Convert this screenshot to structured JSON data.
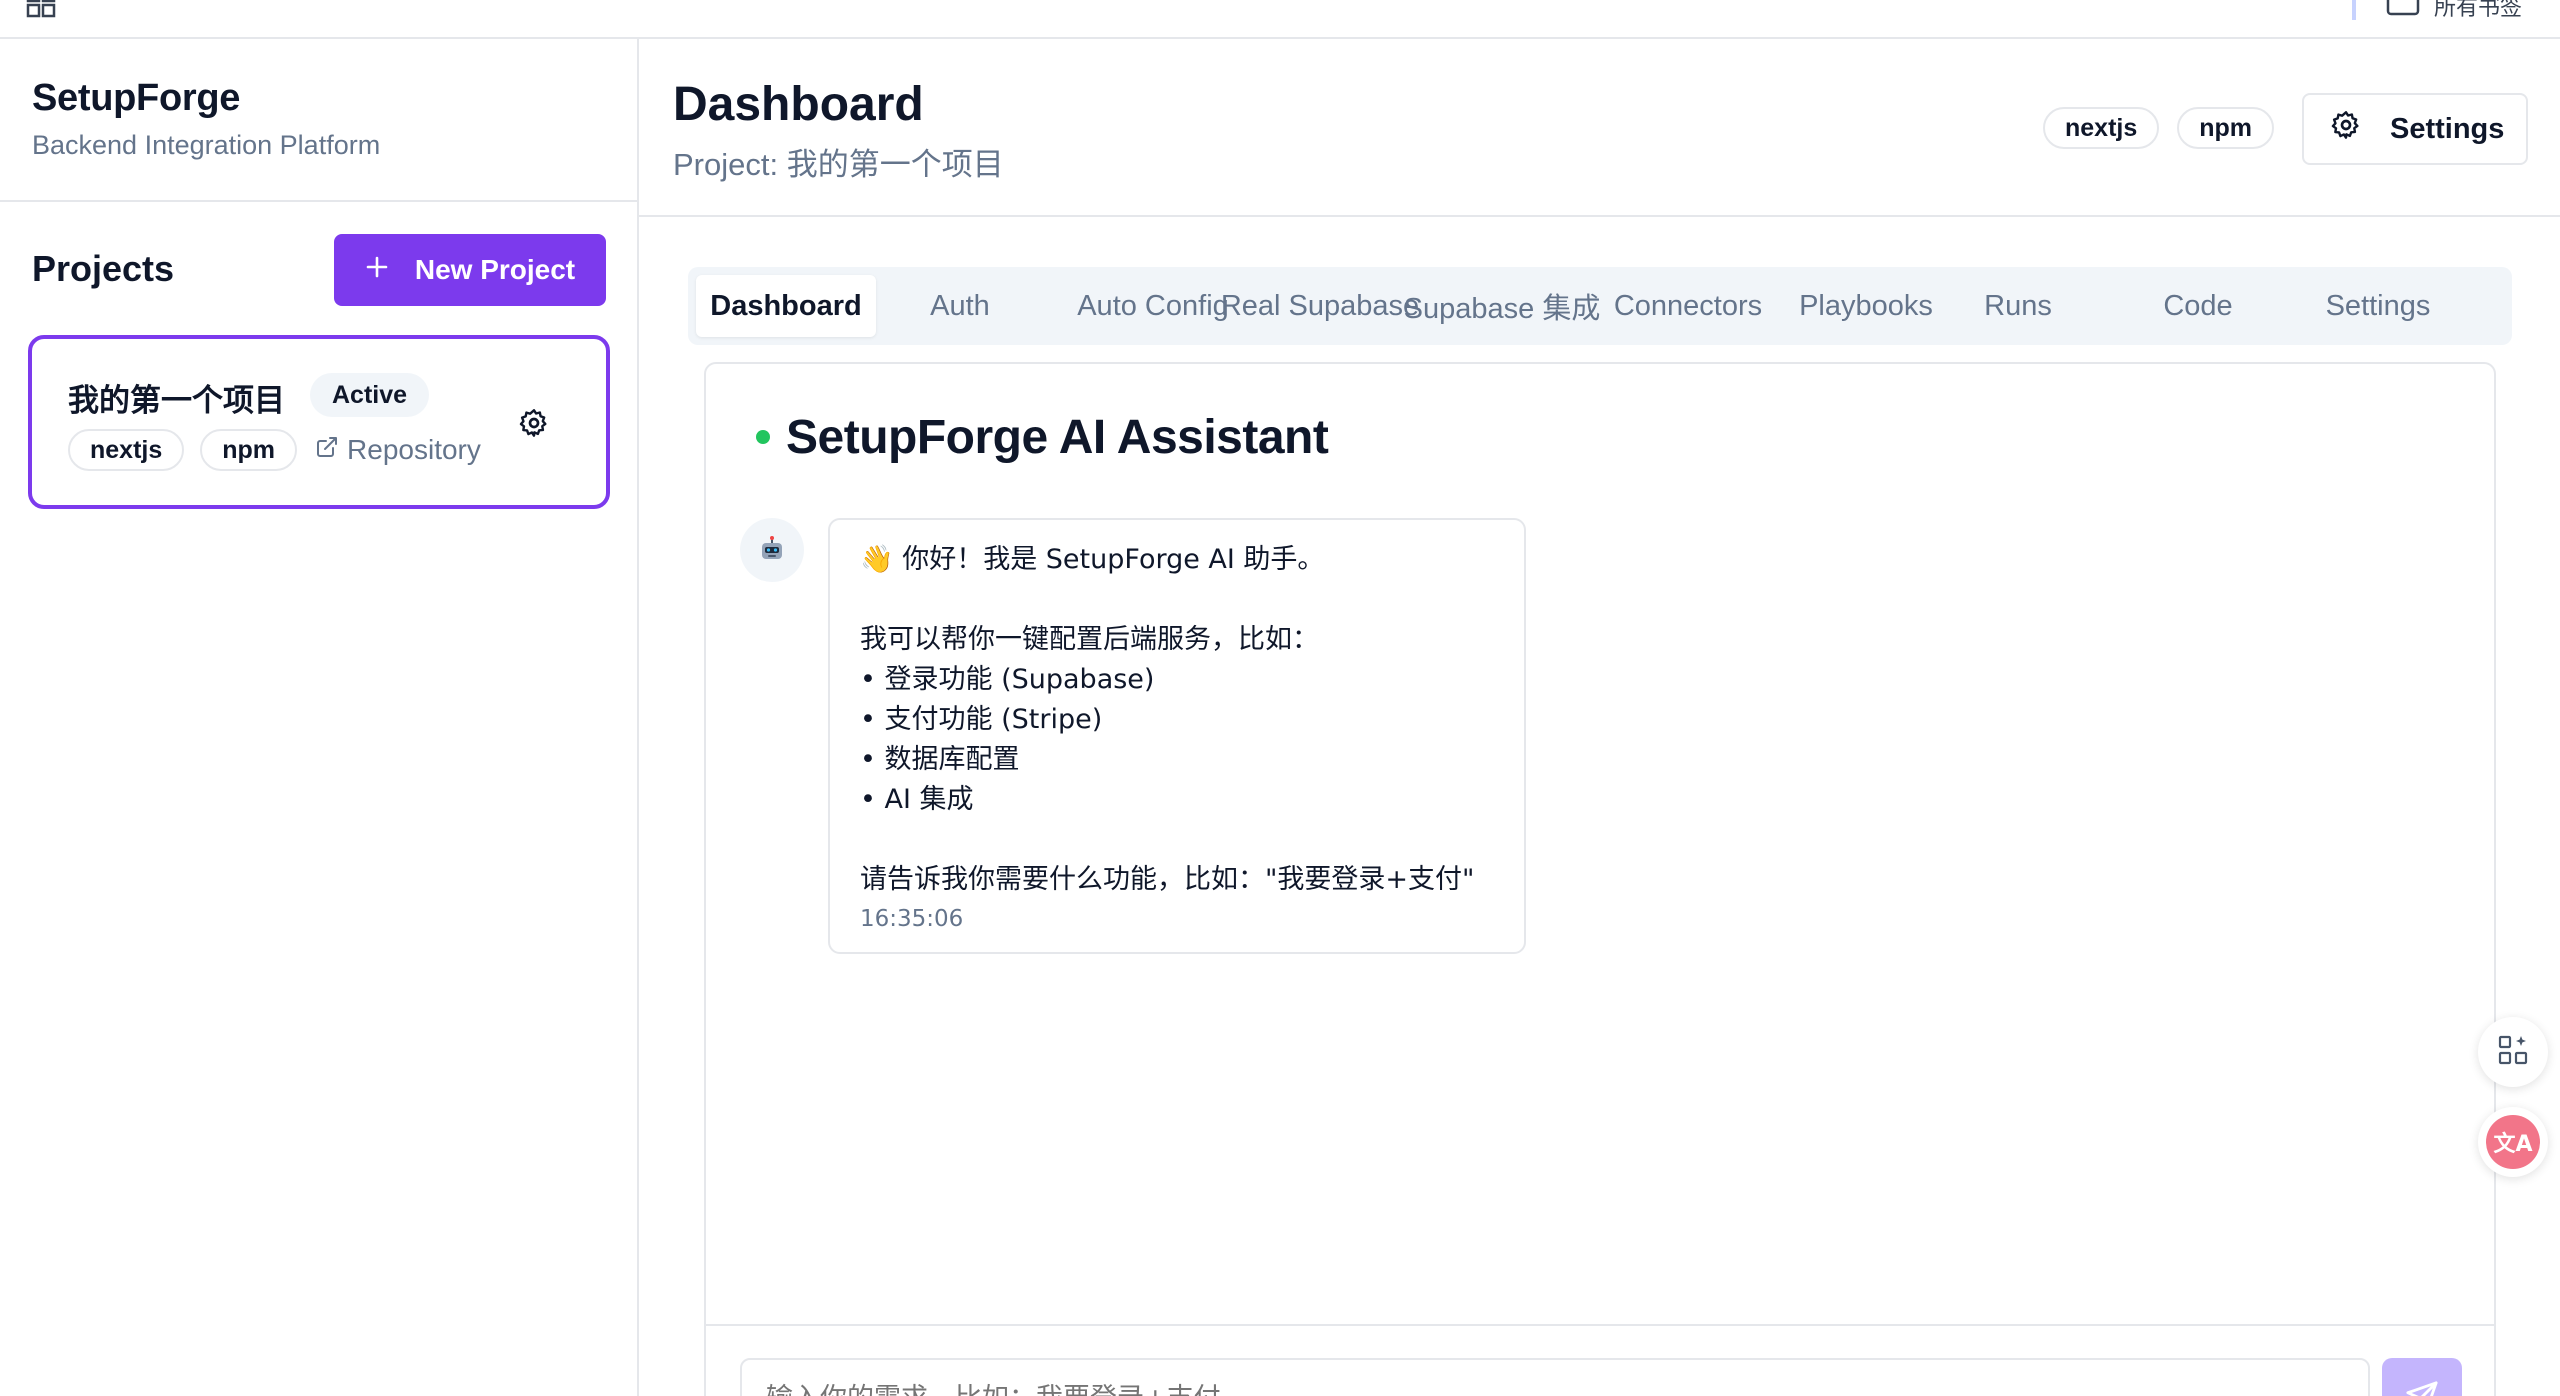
{
  "browser": {
    "bookmark_folder_label": "所有书签"
  },
  "sidebar": {
    "brand_title": "SetupForge",
    "brand_subtitle": "Backend Integration Platform",
    "projects_heading": "Projects",
    "new_project_label": "New Project",
    "project": {
      "name": "我的第一个项目",
      "status": "Active",
      "tags": [
        "nextjs",
        "npm"
      ],
      "repo_label": "Repository"
    }
  },
  "header": {
    "title": "Dashboard",
    "subtitle": "Project: 我的第一个项目",
    "tags": [
      "nextjs",
      "npm"
    ],
    "settings_label": "Settings"
  },
  "tabs": [
    {
      "label": "Dashboard",
      "active": true
    },
    {
      "label": "Auth",
      "active": false
    },
    {
      "label": "Auto Config",
      "active": false
    },
    {
      "label": "Real Supabase",
      "active": false
    },
    {
      "label": "Supabase 集成",
      "active": false
    },
    {
      "label": "Connectors",
      "active": false
    },
    {
      "label": "Playbooks",
      "active": false
    },
    {
      "label": "Runs",
      "active": false
    },
    {
      "label": "Code",
      "active": false
    },
    {
      "label": "Settings",
      "active": false
    }
  ],
  "chat": {
    "title": "SetupForge AI Assistant",
    "status_color": "#22c55e",
    "message": {
      "avatar_icon": "robot-icon",
      "greeting": "👋 你好！我是 SetupForge AI 助手。",
      "intro": "我可以帮你一键配置后端服务，比如：",
      "bullets": [
        "• 登录功能 (Supabase)",
        "• 支付功能 (Stripe)",
        "• 数据库配置",
        "• AI 集成"
      ],
      "prompt": "请告诉我你需要什么功能，比如：\"我要登录+支付\"",
      "time": "16:35:06"
    },
    "input_placeholder": "输入你的需求，比如：我要登录+支付"
  },
  "colors": {
    "accent": "#7c3aed",
    "send_disabled": "#c4b5fd",
    "translate_pink": "#f27589"
  },
  "floating": {
    "translate_glyph": "文A"
  }
}
